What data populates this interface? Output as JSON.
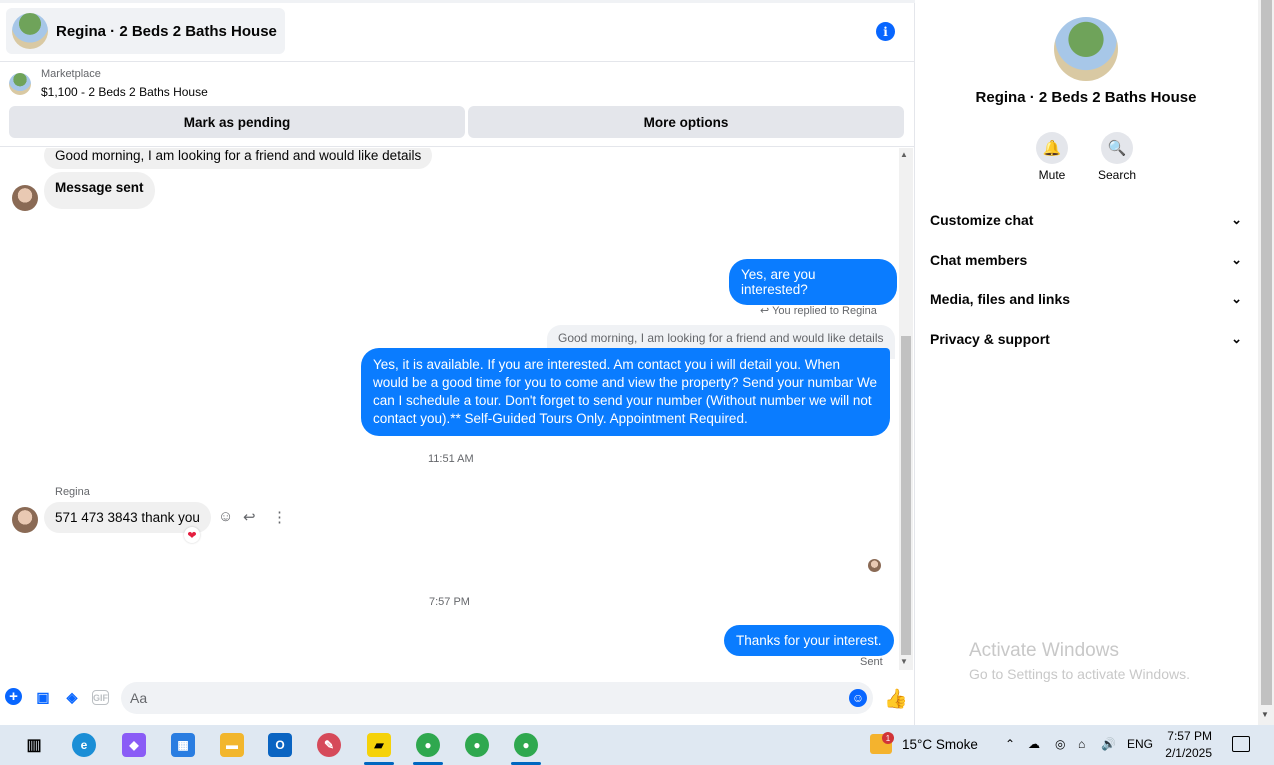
{
  "header": {
    "title": "Regina · 2 Beds 2 Baths House",
    "info_icon": "info-icon"
  },
  "marketplace": {
    "label": "Marketplace",
    "listing": "$1,100 - 2 Beds 2 Baths House",
    "mark_pending": "Mark as pending",
    "more_options": "More options"
  },
  "messages": {
    "incoming_1": "Good morning, I am looking for a friend and would like details",
    "incoming_2": "Message sent",
    "outgoing_1": "Yes, are you interested?",
    "replied_to": "You replied to Regina",
    "quoted": "Good morning, I am looking for a friend and would like details",
    "outgoing_2": "Yes, it is available. If you are interested.  Am contact you i will detail you.  When would be a good time for you to come and view the property? Send your numbar We can I schedule a tour.  Don't forget to send your number (Without number we will not contact you).** Self-Guided Tours Only. Appointment Required.",
    "time_1": "11:51 AM",
    "sender_name": "Regina",
    "incoming_3": "571 473 3843 thank you",
    "time_2": "7:57 PM",
    "outgoing_3": "Thanks for your interest.",
    "status": "Sent"
  },
  "composer": {
    "placeholder": "Aa"
  },
  "panel": {
    "title": "Regina · 2 Beds 2 Baths House",
    "mute": "Mute",
    "search": "Search",
    "menu": [
      "Customize chat",
      "Chat members",
      "Media, files and links",
      "Privacy & support"
    ],
    "watermark_title": "Activate Windows",
    "watermark_sub": "Go to Settings to activate Windows."
  },
  "taskbar": {
    "weather_temp": "15°C  Smoke",
    "weather_badge": "1",
    "lang": "ENG",
    "time": "7:57 PM",
    "date": "2/1/2025"
  },
  "colors": {
    "accent": "#0866ff",
    "outgoing_bubble": "#0a7cff",
    "incoming_bubble": "#f0f0f0"
  }
}
